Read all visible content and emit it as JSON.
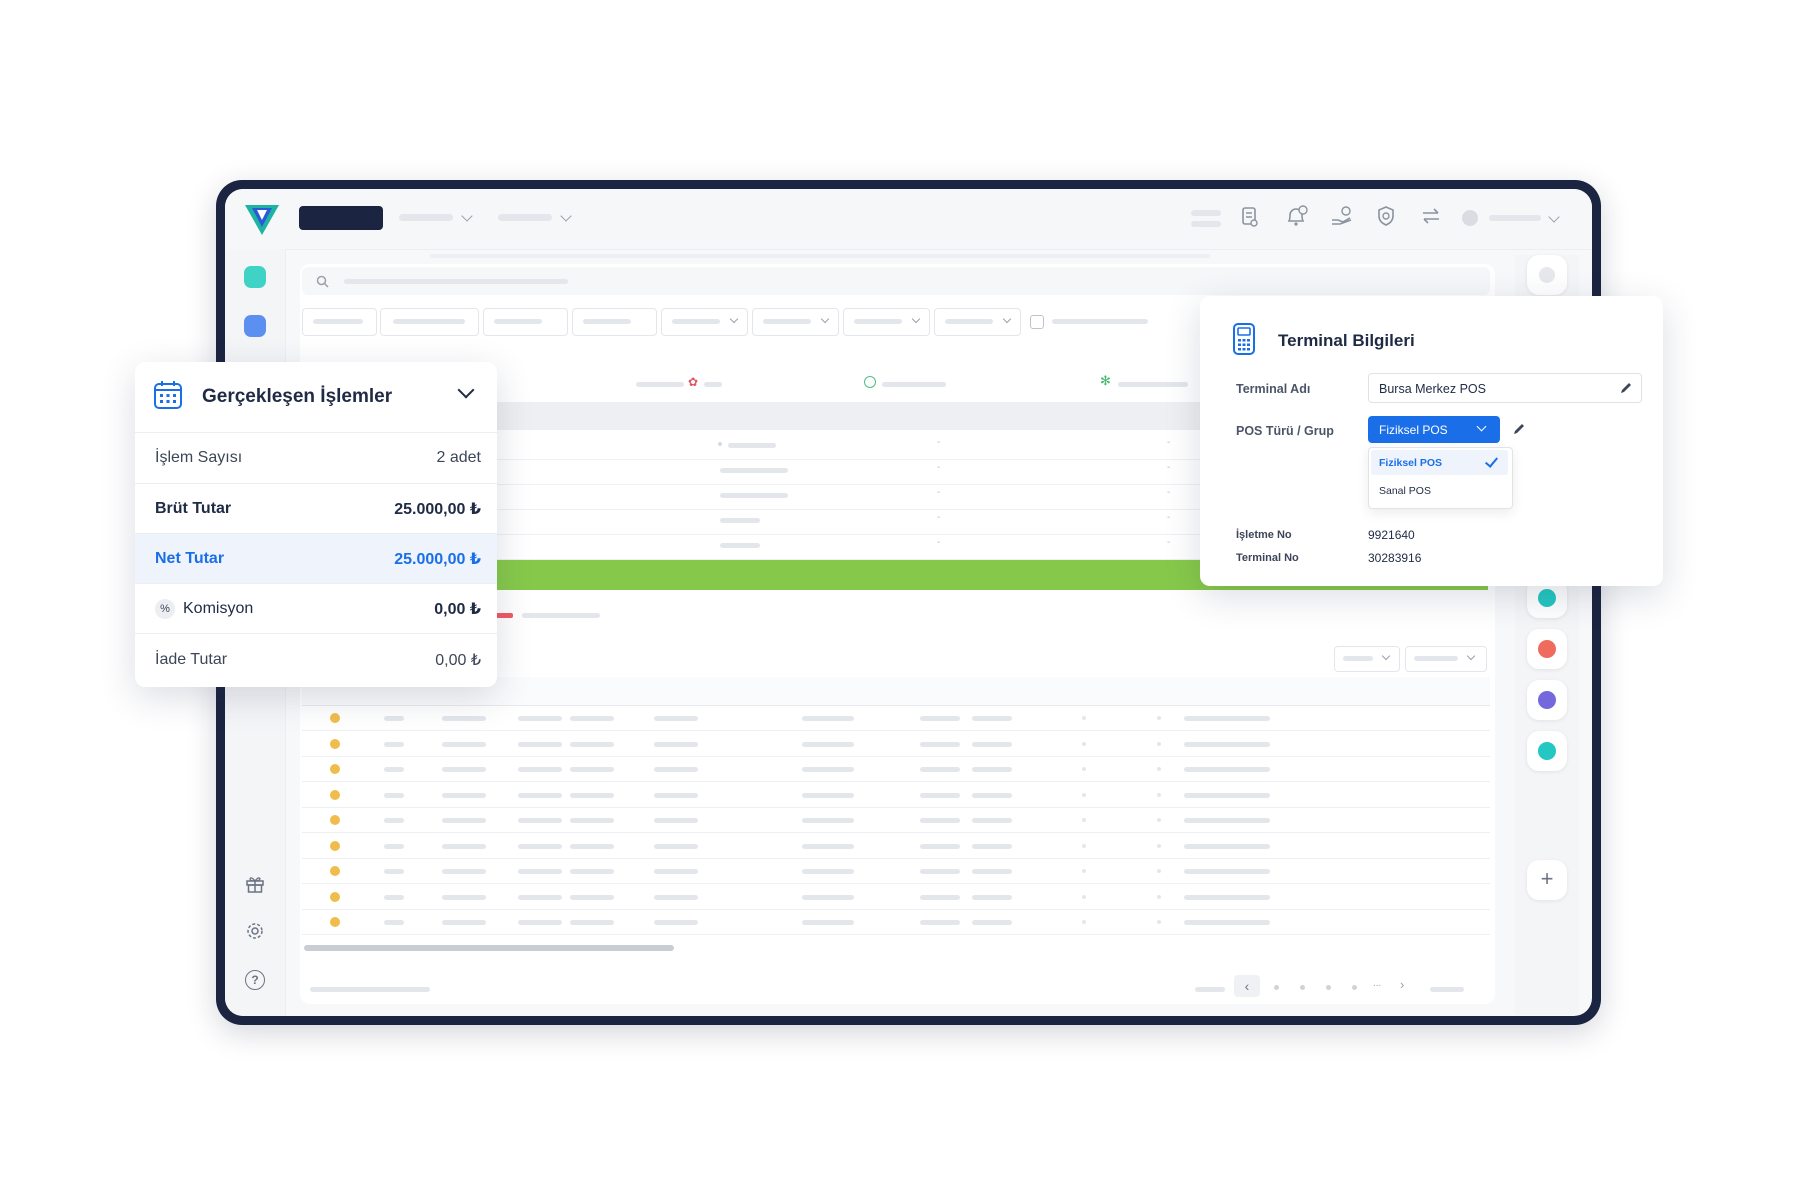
{
  "summary_card": {
    "title": "Gerçekleşen İşlemler",
    "rows": [
      {
        "label": "İşlem Sayısı",
        "value": "2 adet"
      },
      {
        "label": "Brüt Tutar",
        "value": "25.000,00 ₺"
      },
      {
        "label": "Net Tutar",
        "value": "25.000,00 ₺"
      },
      {
        "label": "Komisyon",
        "value": "0,00 ₺",
        "icon_text": "%"
      },
      {
        "label": "İade Tutar",
        "value": "0,00 ₺"
      }
    ]
  },
  "terminal_card": {
    "title": "Terminal Bilgileri",
    "terminal_name_label": "Terminal Adı",
    "terminal_name_value": "Bursa Merkez POS",
    "pos_type_label": "POS Türü / Grup",
    "pos_type_selected": "Fiziksel POS",
    "pos_type_options": [
      "Fiziksel POS",
      "Sanal POS"
    ],
    "business_no_label": "İşletme No",
    "business_no_value": "9921640",
    "terminal_no_label": "Terminal No",
    "terminal_no_value": "30283916"
  },
  "table": {
    "row_dash": "-"
  },
  "pagination": {
    "prev": "‹",
    "next": "›",
    "ellipsis": "..."
  },
  "right_rail": {
    "add_label": "+",
    "dot_colors": [
      "#2f4fb8",
      "#24c7c1",
      "#ef6b5e",
      "#7468dc",
      "#24c7c1"
    ]
  },
  "colors": {
    "accent_blue": "#1a6fe8",
    "green_bar": "#86c94a",
    "row_dot": "#f0bd4c",
    "frame": "#1b2440"
  },
  "icons": [
    "logo-icon",
    "search-icon",
    "calendar-icon",
    "chevron-down-icon",
    "pos-terminal-icon",
    "edit-icon",
    "check-icon",
    "gift-icon",
    "gear-icon",
    "help-icon",
    "bell-icon",
    "document-icon",
    "hand-coin-icon",
    "shield-icon",
    "transfer-icon",
    "plus-icon"
  ]
}
